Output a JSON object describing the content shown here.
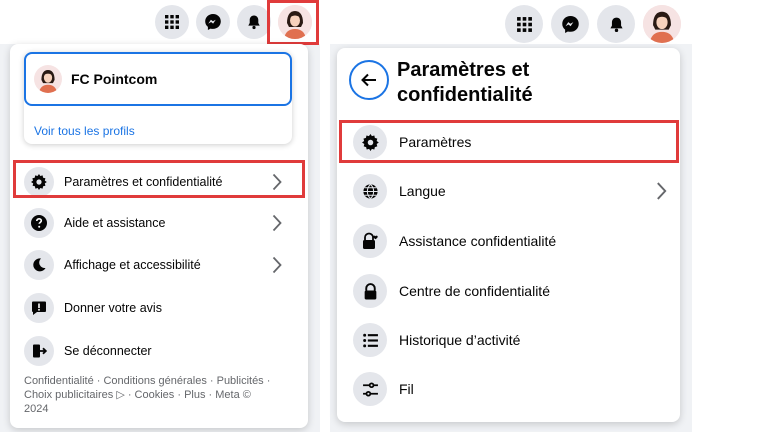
{
  "left_panel": {
    "profile": {
      "name": "FC Pointcom",
      "see_all": "Voir tous les profils"
    },
    "menu": [
      {
        "label": "Paramètres et confidentialité",
        "icon": "gear-icon",
        "chevron": true
      },
      {
        "label": "Aide et assistance",
        "icon": "question-icon",
        "chevron": true
      },
      {
        "label": "Affichage et accessibilité",
        "icon": "moon-icon",
        "chevron": true
      },
      {
        "label": "Donner votre avis",
        "icon": "feedback-icon",
        "chevron": false
      },
      {
        "label": "Se déconnecter",
        "icon": "logout-icon",
        "chevron": false
      }
    ],
    "footer": {
      "line1": "Confidentialité · Conditions générales · Publicités ·",
      "line2": "Choix publicitaires ▷ · Cookies · Plus · Meta ©",
      "line3": "2024"
    }
  },
  "right_panel": {
    "title_line1": "Paramètres et",
    "title_line2": "confidentialité",
    "menu": [
      {
        "label": "Paramètres",
        "icon": "gear-icon",
        "chevron": false
      },
      {
        "label": "Langue",
        "icon": "globe-icon",
        "chevron": true
      },
      {
        "label": "Assistance confidentialité",
        "icon": "lock-heart-icon",
        "chevron": false
      },
      {
        "label": "Centre de confidentialité",
        "icon": "lock-icon",
        "chevron": false
      },
      {
        "label": "Historique d’activité",
        "icon": "list-icon",
        "chevron": false
      },
      {
        "label": "Fil",
        "icon": "sliders-icon",
        "chevron": false
      }
    ]
  },
  "colors": {
    "accent": "#1b74e4",
    "highlight": "#e03b3b",
    "panel_bg": "#f0f2f5",
    "icon_bg": "#e4e6eb"
  }
}
